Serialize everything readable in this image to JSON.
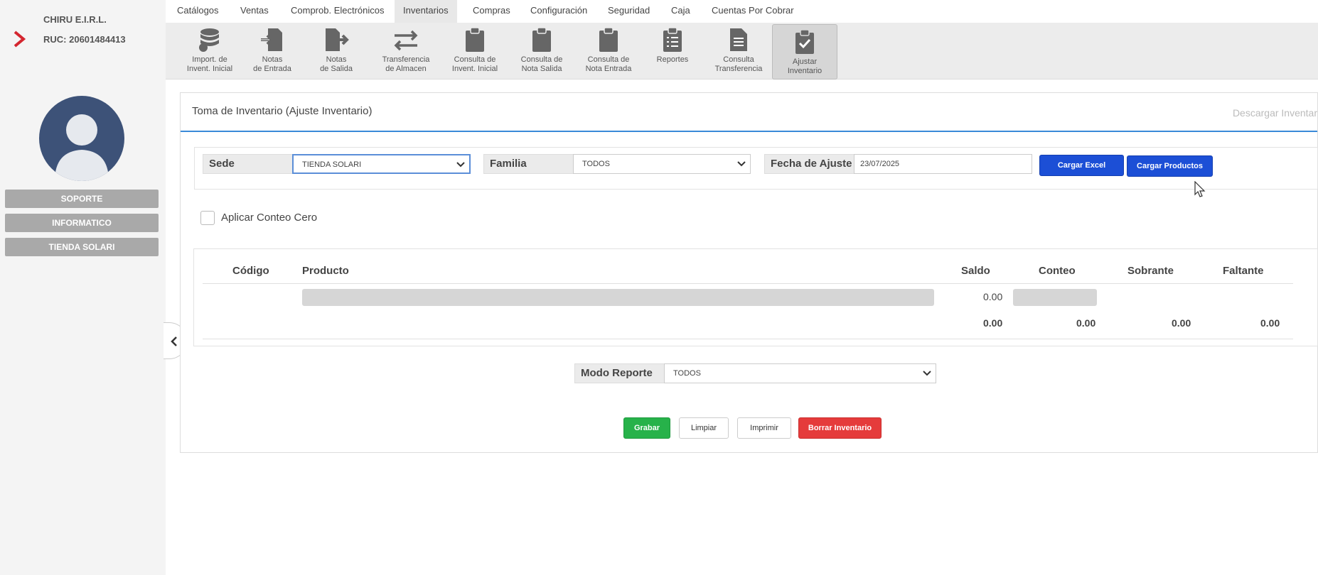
{
  "company": {
    "name": "CHIRU E.I.R.L.",
    "ruc": "RUC: 20601484413"
  },
  "sidebar": {
    "buttons": [
      "SOPORTE",
      "INFORMATICO",
      "TIENDA SOLARI"
    ]
  },
  "topnav": {
    "items": [
      "Catálogos",
      "Ventas",
      "Comprob. Electrónicos",
      "Inventarios",
      "Compras",
      "Configuración",
      "Seguridad",
      "Caja",
      "Cuentas Por Cobrar"
    ],
    "active": "Inventarios"
  },
  "toolbar": {
    "tools": [
      {
        "line1": "Import. de",
        "line2": "Invent. Inicial",
        "icon": "database-icon"
      },
      {
        "line1": "Notas",
        "line2": "de Entrada",
        "icon": "note-in-icon"
      },
      {
        "line1": "Notas",
        "line2": "de Salida",
        "icon": "note-out-icon"
      },
      {
        "line1": "Transferencia",
        "line2": "de Almacen",
        "icon": "transfer-icon"
      },
      {
        "line1": "Consulta de",
        "line2": "Invent. Inicial",
        "icon": "clipboard-icon"
      },
      {
        "line1": "Consulta de",
        "line2": "Nota Salida",
        "icon": "clipboard-icon"
      },
      {
        "line1": "Consulta de",
        "line2": "Nota Entrada",
        "icon": "clipboard-icon"
      },
      {
        "line1": "Reportes",
        "line2": "",
        "icon": "report-icon"
      },
      {
        "line1": "Consulta",
        "line2": "Transferencia",
        "icon": "document-icon"
      },
      {
        "line1": "Ajustar",
        "line2": "Inventario",
        "icon": "clipboard-check-icon"
      }
    ]
  },
  "panel": {
    "title": "Toma de Inventario (Ajuste Inventario)",
    "download": "Descargar Inventar"
  },
  "filters": {
    "sede_label": "Sede",
    "sede_value": "TIENDA SOLARI",
    "familia_label": "Familia",
    "familia_value": "TODOS",
    "fecha_label": "Fecha de Ajuste",
    "fecha_value": "23/07/2025",
    "cargar_excel": "Cargar Excel",
    "cargar_productos": "Cargar Productos"
  },
  "conteo_cero": "Aplicar Conteo Cero",
  "table": {
    "headers": [
      "Código",
      "Producto",
      "Saldo",
      "Conteo",
      "Sobrante",
      "Faltante"
    ],
    "row_saldo": "0.00",
    "totals": [
      "0.00",
      "0.00",
      "0.00",
      "0.00"
    ]
  },
  "modo_reporte": {
    "label": "Modo Reporte",
    "value": "TODOS"
  },
  "actions": {
    "grabar": "Grabar",
    "limpiar": "Limpiar",
    "imprimir": "Imprimir",
    "borrar": "Borrar Inventario"
  },
  "colors": {
    "accent": "#1c4fd6",
    "green": "#27b24a",
    "red": "#e53b3b",
    "sidebar_btn": "#a9a9a9"
  }
}
